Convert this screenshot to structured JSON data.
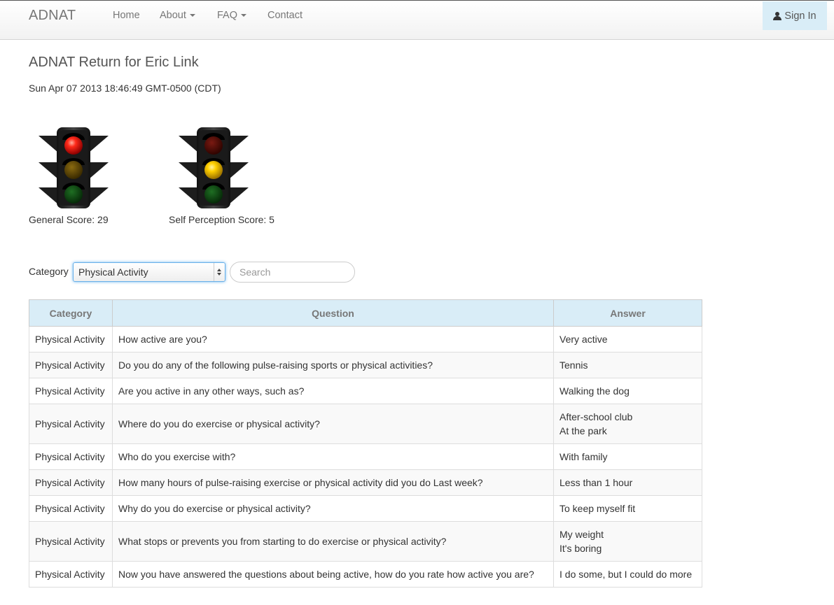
{
  "navbar": {
    "brand": "ADNAT",
    "items": [
      {
        "label": "Home",
        "dropdown": false
      },
      {
        "label": "About",
        "dropdown": true
      },
      {
        "label": "FAQ",
        "dropdown": true
      },
      {
        "label": "Contact",
        "dropdown": false
      }
    ],
    "signin_label": "Sign In",
    "signin_icon": "user-icon"
  },
  "page": {
    "title": "ADNAT Return for Eric Link",
    "timestamp": "Sun Apr 07 2013 18:46:49 GMT-0500 (CDT)"
  },
  "scores": [
    {
      "label": "General Score: 29",
      "active_light": "red",
      "icon": "traffic-light-icon"
    },
    {
      "label": "Self Perception Score: 5",
      "active_light": "amber",
      "icon": "traffic-light-icon"
    }
  ],
  "filter": {
    "category_label": "Category",
    "category_selected": "Physical Activity",
    "search_placeholder": "Search"
  },
  "table": {
    "headers": {
      "category": "Category",
      "question": "Question",
      "answer": "Answer"
    },
    "rows": [
      {
        "category": "Physical Activity",
        "question": "How active are you?",
        "answer": [
          "Very active"
        ]
      },
      {
        "category": "Physical Activity",
        "question": "Do you do any of the following pulse-raising sports or physical activities?",
        "answer": [
          "Tennis"
        ]
      },
      {
        "category": "Physical Activity",
        "question": "Are you active in any other ways, such as?",
        "answer": [
          "Walking the dog"
        ]
      },
      {
        "category": "Physical Activity",
        "question": "Where do you do exercise or physical activity?",
        "answer": [
          "After-school club",
          "At the park"
        ]
      },
      {
        "category": "Physical Activity",
        "question": "Who do you exercise with?",
        "answer": [
          "With family"
        ]
      },
      {
        "category": "Physical Activity",
        "question": "How many hours of pulse-raising exercise or physical activity did you do Last week?",
        "answer": [
          "Less than 1 hour"
        ]
      },
      {
        "category": "Physical Activity",
        "question": "Why do you do exercise or physical activity?",
        "answer": [
          "To keep myself fit"
        ]
      },
      {
        "category": "Physical Activity",
        "question": "What stops or prevents you from starting to do exercise or physical activity?",
        "answer": [
          "My weight",
          "It's boring"
        ]
      },
      {
        "category": "Physical Activity",
        "question": "Now you have answered the questions about being active, how do you rate how active you are?",
        "answer": [
          "I do some, but I could do more"
        ]
      }
    ]
  },
  "colors": {
    "navbar_bg": "#f5f5f5",
    "signin_bg": "#d9edf7",
    "table_header_bg": "#d9edf7",
    "light_red_on": "#ff2a1a",
    "light_amber_on": "#ffd000",
    "light_green_off": "#0b4d10"
  }
}
